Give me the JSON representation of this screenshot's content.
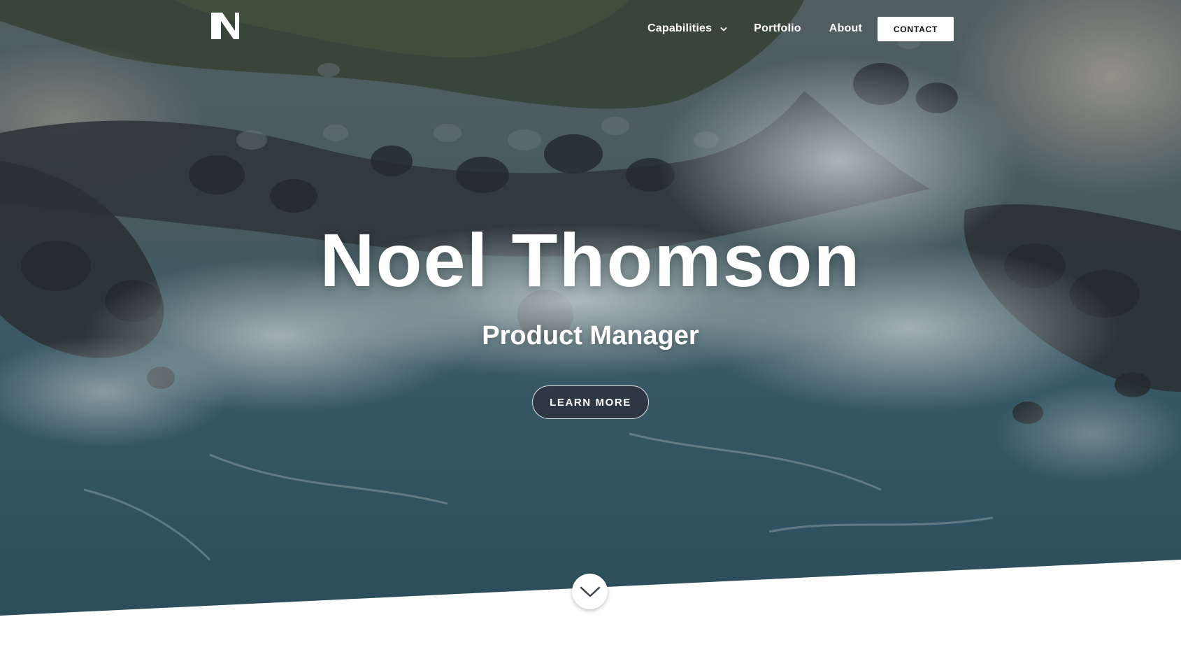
{
  "brand": {
    "logo_icon": "n-letter-logo-icon"
  },
  "nav": {
    "items": [
      {
        "label": "Capabilities",
        "icon": "chevron-down-icon"
      },
      {
        "label": "Portfolio"
      },
      {
        "label": "About"
      }
    ],
    "contact_label": "CONTACT"
  },
  "hero": {
    "title": "Noel Thomson",
    "subtitle": "Product Manager",
    "cta_label": "LEARN MORE",
    "background": "aerial ocean waves on rocky shore",
    "scroll_icon": "chevron-down-icon"
  },
  "colors": {
    "text": "#ffffff",
    "button_dark": "#2c313d",
    "page_background": "#ffffff"
  }
}
